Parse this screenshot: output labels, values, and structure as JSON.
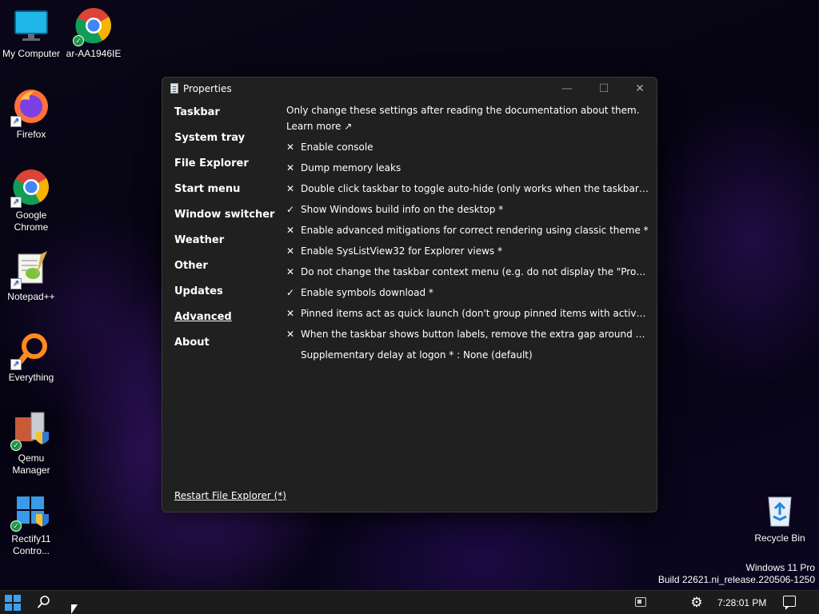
{
  "desktop": {
    "icons": [
      {
        "label": "My Computer"
      },
      {
        "label": "ar-AA1946IE"
      },
      {
        "label": "Firefox"
      },
      {
        "label": "Google Chrome"
      },
      {
        "label": "Notepad++"
      },
      {
        "label": "Everything"
      },
      {
        "label": "Qemu Manager"
      },
      {
        "label": "Rectify11 Contro..."
      },
      {
        "label": "Recycle Bin"
      }
    ],
    "watermark": {
      "line1": "Windows 11 Pro",
      "line2": "Build 22621.ni_release.220506-1250"
    }
  },
  "window": {
    "title": "Properties",
    "controls": {
      "minimize": "—",
      "maximize": "☐",
      "close": "✕"
    },
    "sidebar": {
      "items": [
        {
          "label": "Taskbar"
        },
        {
          "label": "System tray"
        },
        {
          "label": "File Explorer"
        },
        {
          "label": "Start menu"
        },
        {
          "label": "Window switcher"
        },
        {
          "label": "Weather"
        },
        {
          "label": "Other"
        },
        {
          "label": "Updates"
        },
        {
          "label": "Advanced",
          "active": true
        },
        {
          "label": "About"
        }
      ]
    },
    "content": {
      "intro": "Only change these settings after reading the documentation about them.",
      "learn_more": "Learn more ↗",
      "options": [
        {
          "mark": "✕",
          "label": "Enable console"
        },
        {
          "mark": "✕",
          "label": "Dump memory leaks"
        },
        {
          "mark": "✕",
          "label": "Double click taskbar to toggle auto-hide (only works when the taskbar is locked)"
        },
        {
          "mark": "✓",
          "label": "Show Windows build info on the desktop *"
        },
        {
          "mark": "✕",
          "label": "Enable advanced mitigations for correct rendering using classic theme *"
        },
        {
          "mark": "✕",
          "label": "Enable SysListView32 for Explorer views *"
        },
        {
          "mark": "✕",
          "label": "Do not change the taskbar context menu (e.g. do not display the \"Properties\" ite..."
        },
        {
          "mark": "✓",
          "label": "Enable symbols download *"
        },
        {
          "mark": "✕",
          "label": "Pinned items act as quick launch (don't group pinned items with active apps) *"
        },
        {
          "mark": "✕",
          "label": "When the taskbar shows button labels, remove the extra gap around pinned ite..."
        },
        {
          "mark": "",
          "label": "Supplementary delay at logon * : None (default)"
        }
      ]
    },
    "restart_link": "Restart File Explorer (*)"
  },
  "taskbar": {
    "clock": "7:28:01 PM",
    "search_icon": "🔍",
    "settings_icon": "⚙"
  },
  "colors": {
    "window_bg": "#202020",
    "taskbar_bg": "#1c1c1c",
    "accent": "#3aa0f0"
  }
}
